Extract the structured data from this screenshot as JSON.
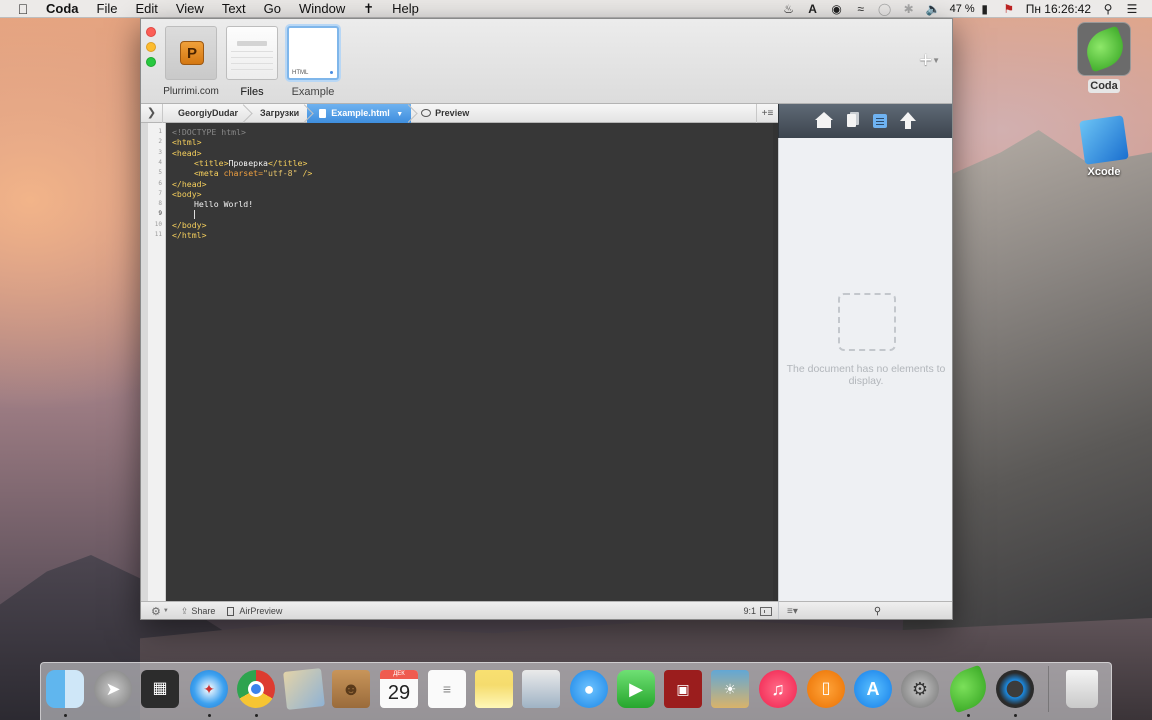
{
  "menubar": {
    "app_name": "Coda",
    "items": [
      "File",
      "Edit",
      "View",
      "Text",
      "Go",
      "Window",
      "Help"
    ],
    "battery": "47 %",
    "clock": "Пн 16:26:42"
  },
  "desktop": {
    "icons": [
      {
        "label": "Coda"
      },
      {
        "label": "Xcode"
      }
    ]
  },
  "window": {
    "sites": [
      {
        "name": "Plurrimi.com",
        "logo": "P"
      },
      {
        "name": "Files"
      },
      {
        "name": "Example",
        "thumb_tag": "HTML"
      }
    ],
    "pathbar": {
      "crumbs": [
        "GeorgiyDudar",
        "Загрузки",
        "Example.html"
      ],
      "preview_label": "Preview"
    },
    "editor": {
      "line_numbers": [
        "1",
        "2",
        "3",
        "4",
        "5",
        "6",
        "7",
        "8",
        "9",
        "10",
        "11"
      ],
      "lines": {
        "l1": "<!DOCTYPE html>",
        "l2": "<html>",
        "l3": "<head>",
        "l4_open": "<title>",
        "l4_text": "Проверка",
        "l4_close": "</title>",
        "l5_tag": "<meta",
        "l5_attr": "charset=",
        "l5_val": "\"utf-8\"",
        "l5_end": "/>",
        "l6": "</head>",
        "l7": "<body>",
        "l8": "Hello World!",
        "l10": "</body>",
        "l11": "</html>"
      },
      "cursor_position": "9:1"
    },
    "statusbar": {
      "share_label": "Share",
      "airpreview_label": "AirPreview"
    },
    "sidebar": {
      "empty_message": "The document has no elements to display."
    }
  },
  "dock": {
    "calendar_month": "ДЕК",
    "calendar_day": "29"
  }
}
